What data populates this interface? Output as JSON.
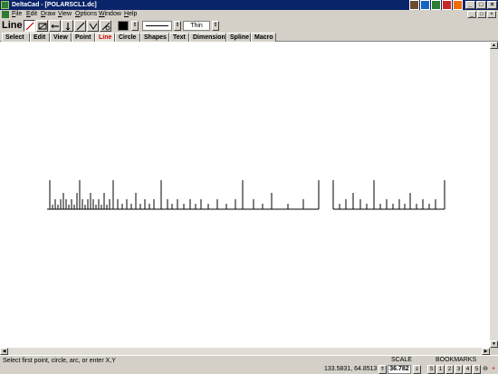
{
  "window": {
    "title": "DeltaCad - [POLARSCL1.dc]"
  },
  "menu": [
    "File",
    "Edit",
    "Draw",
    "View",
    "Options",
    "Window",
    "Help"
  ],
  "toolbar": {
    "mode_label": "Line",
    "line_width": "Thin",
    "tools": [
      "line-tool-icon",
      "rectangle-tool-icon",
      "horizontal-line-icon",
      "vertical-line-icon",
      "angled-line-icon",
      "polyline-icon",
      "tangent-line-icon"
    ],
    "color": "#000000"
  },
  "tabs": [
    "Select",
    "Edit",
    "View",
    "Point",
    "Line",
    "Circle",
    "Shapes",
    "Text",
    "Dimension",
    "Spline",
    "Macro"
  ],
  "active_tab": "Line",
  "status": {
    "prompt": "Select first point, circle, arc, or enter X,Y",
    "coordinates": "133.5831, 64.8513",
    "scale_label": "SCALE",
    "scale_value": "36.782",
    "bookmarks_label": "BOOKMARKS",
    "bookmarks": [
      "S",
      "1",
      "2",
      "3",
      "4",
      "5"
    ]
  },
  "accent_color": "#0a246a",
  "active_tab_color": "#cc0000"
}
